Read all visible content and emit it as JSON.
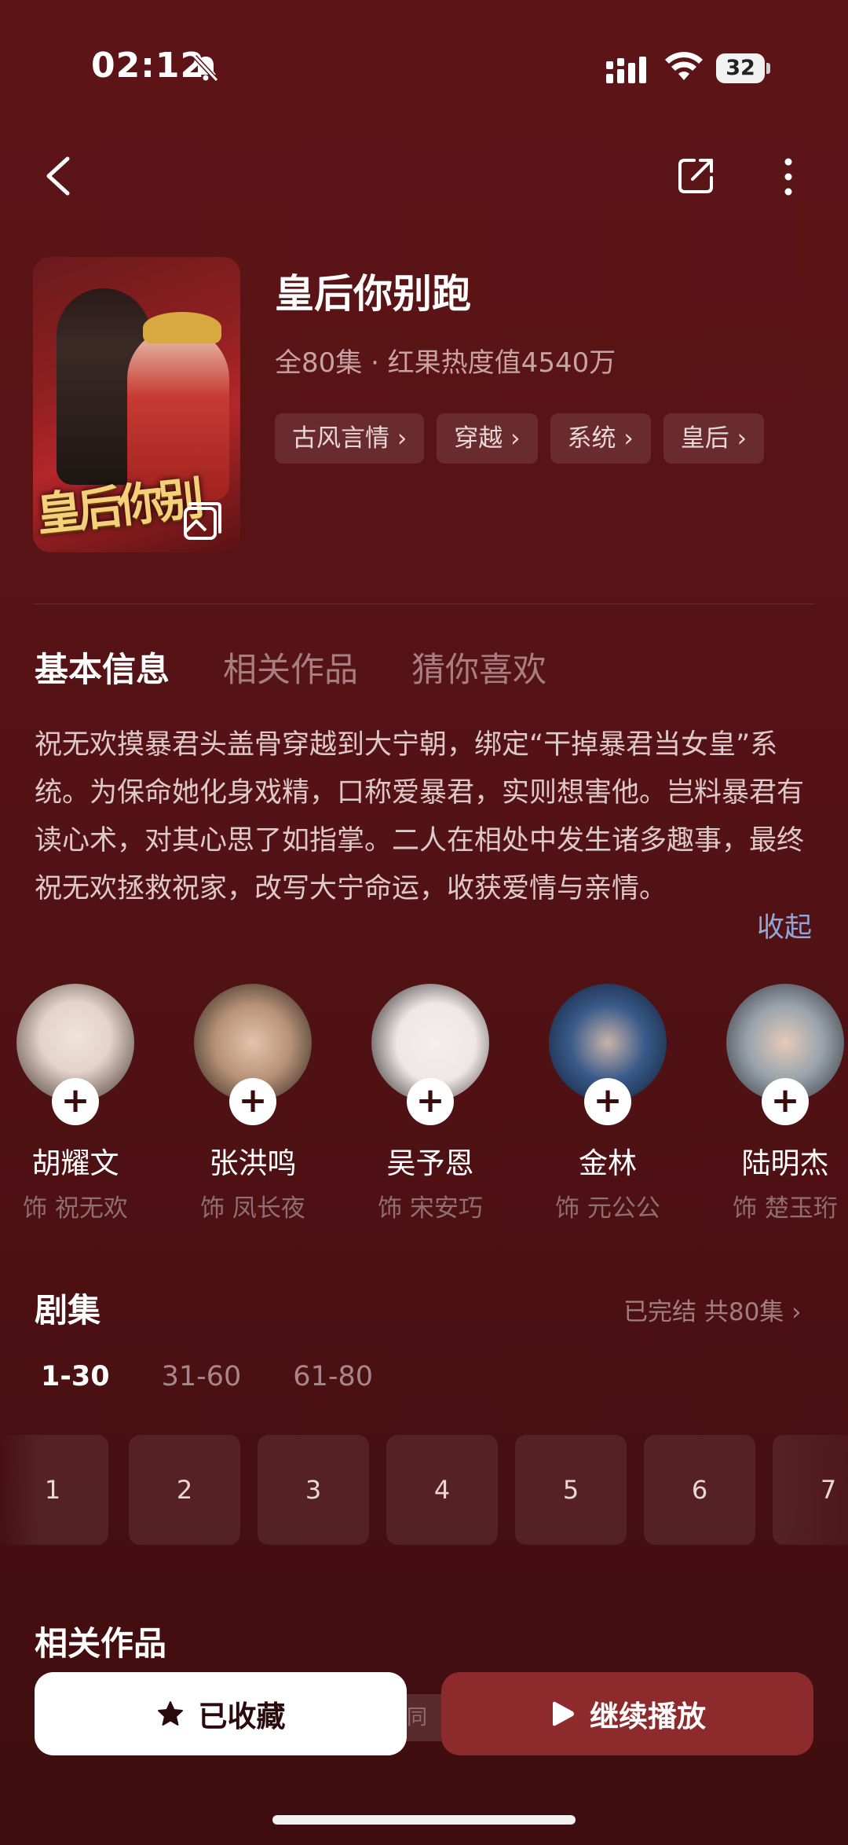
{
  "status": {
    "time": "02:12",
    "battery": "32"
  },
  "show": {
    "title": "皇后你别跑",
    "meta": "全80集 · 红果热度值4540万",
    "poster_text": "皇后你别跑",
    "tags": [
      "古风言情 ›",
      "穿越 ›",
      "系统 ›",
      "皇后 ›"
    ]
  },
  "tabs": [
    "基本信息",
    "相关作品",
    "猜你喜欢"
  ],
  "description": "祝无欢摸暴君头盖骨穿越到大宁朝，绑定“干掉暴君当女皇”系统。为保命她化身戏精，口称爱暴君，实则想害他。岂料暴君有读心术，对其心思了如指掌。二人在相处中发生诸多趣事，最终祝无欢拯救祝家，改写大宁命运，收获爱情与亲情。",
  "collapse_label": "收起",
  "cast": [
    {
      "name": "胡耀文",
      "role": "饰 祝无欢",
      "color1": "#e9ddd6",
      "color2": "#3a2a26"
    },
    {
      "name": "张洪鸣",
      "role": "饰 凤长夜",
      "color1": "#c8a98f",
      "color2": "#1f1a18"
    },
    {
      "name": "吴予恩",
      "role": "饰 宋安巧",
      "color1": "#f3ecec",
      "color2": "#1a1515"
    },
    {
      "name": "金林",
      "role": "饰 元公公",
      "color1": "#1f3c66",
      "color2": "#0d1a2e"
    },
    {
      "name": "陆明杰",
      "role": "饰 楚玉珩",
      "color1": "#9aa3ad",
      "color2": "#2a2d33"
    }
  ],
  "episodes": {
    "title": "剧集",
    "status": "已完结 共80集 ›",
    "ranges": [
      "1-30",
      "31-60",
      "61-80"
    ],
    "visible": [
      "1",
      "2",
      "3",
      "4",
      "5",
      "6",
      "7"
    ]
  },
  "related_title": "相关作品",
  "buttons": {
    "collect": "已收藏",
    "play": "继续播放",
    "peek": "同"
  }
}
